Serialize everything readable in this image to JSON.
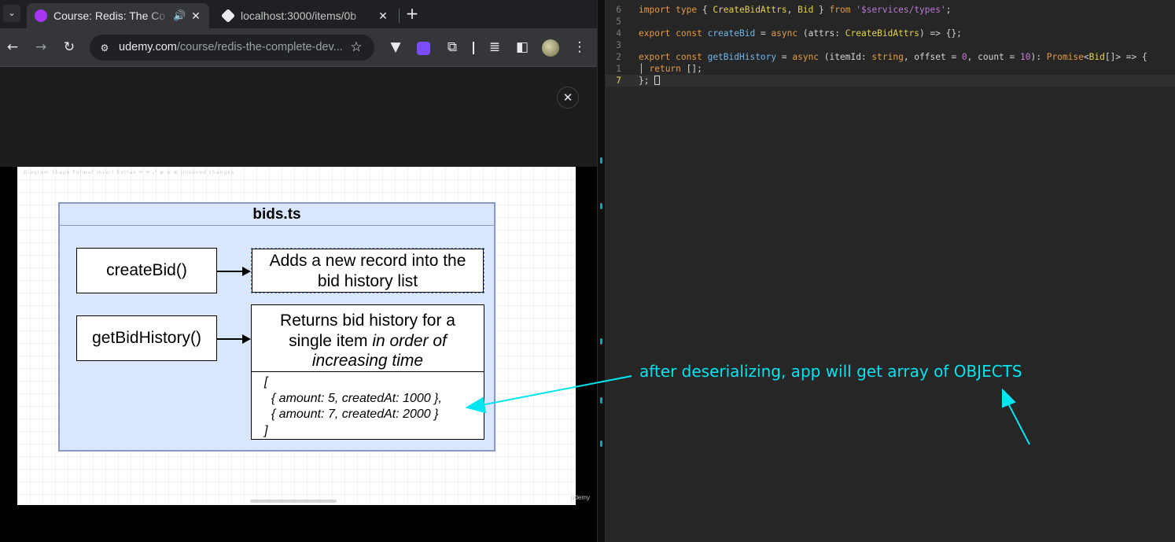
{
  "browser": {
    "tabs": [
      {
        "title": "Course: Redis: The Co",
        "active": true
      },
      {
        "title": "localhost:3000/items/0b",
        "active": false
      }
    ],
    "url_domain": "udemy.com",
    "url_path": "/course/redis-the-complete-dev...",
    "close_label": "✕"
  },
  "slide": {
    "menu_text": "Diagram   Shape  Format   Insert   Extras   ⟲ ⟳   ⤢  ⊕  ⊖   ⊞ Unsaved changes",
    "watermark": "udemy",
    "title": "bids.ts",
    "functions": [
      {
        "name": "createBid()",
        "description_lines": [
          "Adds a new record into the",
          "bid history list"
        ]
      },
      {
        "name": "getBidHistory()",
        "description_line1": "Returns bid history for a",
        "description_line2_plain": "single item ",
        "description_line2_italic": "in order of",
        "description_line3_italic": "increasing time"
      }
    ],
    "example_lines": [
      "[",
      "  { amount: 5, createdAt: 1000 },",
      "  { amount: 7, createdAt: 2000 }",
      "]"
    ]
  },
  "editor": {
    "lines": [
      {
        "num": "6",
        "tokens": [
          [
            "kw",
            "import type"
          ],
          [
            "ident",
            " { "
          ],
          [
            "ty",
            "CreateBidAttrs"
          ],
          [
            "ident",
            ", "
          ],
          [
            "ty",
            "Bid"
          ],
          [
            "ident",
            " } "
          ],
          [
            "kw",
            "from"
          ],
          [
            "ident",
            " "
          ],
          [
            "str",
            "'$services/types'"
          ],
          [
            "ident",
            ";"
          ]
        ]
      },
      {
        "num": "5",
        "tokens": []
      },
      {
        "num": "4",
        "tokens": [
          [
            "kw",
            "export const"
          ],
          [
            "ident",
            " "
          ],
          [
            "fn",
            "createBid"
          ],
          [
            "ident",
            " = "
          ],
          [
            "kw",
            "async"
          ],
          [
            "ident",
            " (attrs: "
          ],
          [
            "ty",
            "CreateBidAttrs"
          ],
          [
            "ident",
            ") => {};"
          ]
        ]
      },
      {
        "num": "3",
        "tokens": []
      },
      {
        "num": "2",
        "tokens": [
          [
            "kw",
            "export const"
          ],
          [
            "ident",
            " "
          ],
          [
            "fn",
            "getBidHistory"
          ],
          [
            "ident",
            " = "
          ],
          [
            "kw",
            "async"
          ],
          [
            "ident",
            " (itemId: "
          ],
          [
            "kw",
            "string"
          ],
          [
            "ident",
            ", offset = "
          ],
          [
            "num",
            "0"
          ],
          [
            "ident",
            ", count = "
          ],
          [
            "num",
            "10"
          ],
          [
            "ident",
            "): "
          ],
          [
            "kw",
            "Promise"
          ],
          [
            "ident",
            "<"
          ],
          [
            "ty",
            "Bid"
          ],
          [
            "ident",
            "[]> => {"
          ]
        ]
      },
      {
        "num": "1",
        "tokens": [
          [
            "ident",
            "│ "
          ],
          [
            "kw",
            "return"
          ],
          [
            "ident",
            " [];"
          ]
        ]
      },
      {
        "num": "7",
        "tokens": [
          [
            "ident",
            "}; "
          ]
        ],
        "current": true
      }
    ]
  },
  "annotation": {
    "text": "after deserializing, app will get array of OBJECTS",
    "color": "#00e5f0"
  },
  "colors": {
    "slide_frame_fill": "#dae6fb",
    "slide_frame_stroke": "#8a98c4",
    "udemy_purple": "#a435f0",
    "editor_bg": "#262626"
  }
}
